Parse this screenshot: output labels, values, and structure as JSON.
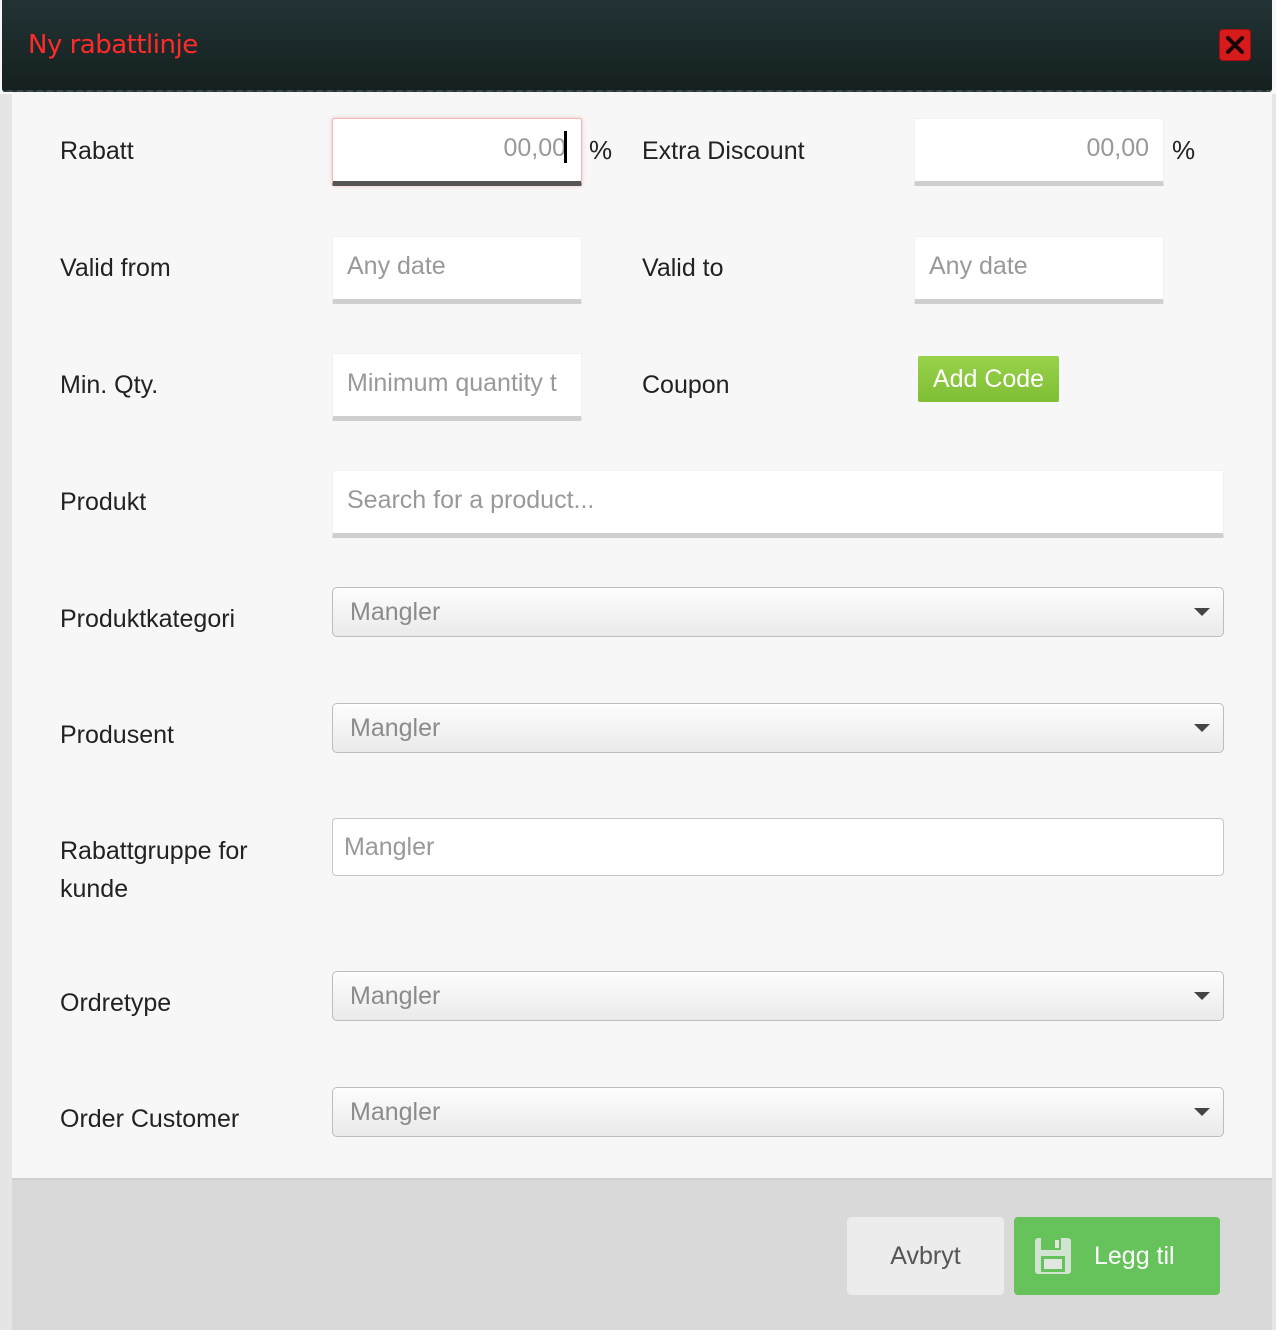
{
  "dialog": {
    "title": "Ny rabattlinje",
    "close_icon": "close-icon"
  },
  "fields": {
    "rabatt": {
      "label": "Rabatt",
      "value": "00,00",
      "unit": "%"
    },
    "extra_discount": {
      "label": "Extra Discount",
      "value": "00,00",
      "unit": "%"
    },
    "valid_from": {
      "label": "Valid from",
      "placeholder": "Any date"
    },
    "valid_to": {
      "label": "Valid to",
      "placeholder": "Any date"
    },
    "min_qty": {
      "label": "Min. Qty.",
      "placeholder": "Minimum quantity t"
    },
    "coupon": {
      "label": "Coupon",
      "button": "Add Code"
    },
    "produkt": {
      "label": "Produkt",
      "placeholder": "Search for a product..."
    },
    "produktkategori": {
      "label": "Produktkategori",
      "value": "Mangler"
    },
    "produsent": {
      "label": "Produsent",
      "value": "Mangler"
    },
    "rabattgruppe": {
      "label_line1": "Rabattgruppe for",
      "label_line2": "kunde",
      "placeholder": "Mangler"
    },
    "ordretype": {
      "label": "Ordretype",
      "value": "Mangler"
    },
    "order_customer": {
      "label": "Order Customer",
      "value": "Mangler"
    }
  },
  "footer": {
    "cancel_label": "Avbryt",
    "add_label": "Legg til",
    "add_icon": "save-icon"
  },
  "colors": {
    "title_red": "#ff2a2a",
    "titlebar": "#1c2b2d",
    "coupon_green": "#8bc63f",
    "add_green": "#66c25a",
    "close_red": "#d71a1a"
  }
}
